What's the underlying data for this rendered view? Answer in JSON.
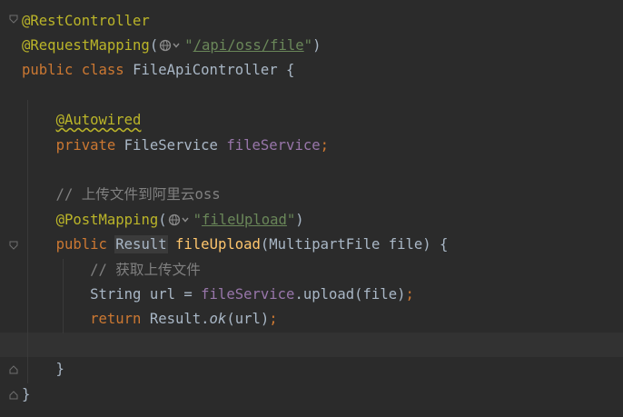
{
  "editor": {
    "lines": [
      {
        "parts": [
          {
            "t": "@RestController",
            "c": "ann"
          }
        ]
      },
      {
        "parts": [
          {
            "t": "@RequestMapping",
            "c": "ann"
          },
          {
            "t": "(",
            "c": ""
          },
          {
            "inlay": "globe-icon"
          },
          {
            "t": "\"",
            "c": "str"
          },
          {
            "t": "/api/oss/file",
            "c": "str-link"
          },
          {
            "t": "\"",
            "c": "str"
          },
          {
            "t": ")",
            "c": ""
          }
        ]
      },
      {
        "parts": [
          {
            "t": "public class ",
            "c": "kw"
          },
          {
            "t": "FileApiController {",
            "c": ""
          }
        ]
      },
      {
        "parts": []
      },
      {
        "parts": [
          {
            "t": "    ",
            "c": ""
          },
          {
            "t": "@Autowired",
            "c": "ann warn-underline"
          }
        ]
      },
      {
        "parts": [
          {
            "t": "    ",
            "c": ""
          },
          {
            "t": "private ",
            "c": "kw"
          },
          {
            "t": "FileService ",
            "c": ""
          },
          {
            "t": "fileService",
            "c": "fld"
          },
          {
            "t": ";",
            "c": "kw"
          }
        ]
      },
      {
        "parts": []
      },
      {
        "parts": [
          {
            "t": "    // 上传文件到阿里云oss",
            "c": "cmt"
          }
        ]
      },
      {
        "parts": [
          {
            "t": "    ",
            "c": ""
          },
          {
            "t": "@PostMapping",
            "c": "ann"
          },
          {
            "t": "(",
            "c": ""
          },
          {
            "inlay": "globe-icon"
          },
          {
            "t": "\"",
            "c": "str"
          },
          {
            "t": "fileUpload",
            "c": "str-link"
          },
          {
            "t": "\"",
            "c": "str"
          },
          {
            "t": ")",
            "c": ""
          }
        ]
      },
      {
        "parts": [
          {
            "t": "    ",
            "c": ""
          },
          {
            "t": "public ",
            "c": "kw"
          },
          {
            "t": "Result",
            "c": "hl-usage"
          },
          {
            "t": " ",
            "c": ""
          },
          {
            "t": "fileUpload",
            "c": "method-decl"
          },
          {
            "t": "(MultipartFile file) {",
            "c": ""
          }
        ]
      },
      {
        "parts": [
          {
            "t": "        // 获取上传文件",
            "c": "cmt"
          }
        ]
      },
      {
        "parts": [
          {
            "t": "        String url = ",
            "c": ""
          },
          {
            "t": "fileService",
            "c": "fld"
          },
          {
            "t": ".upload(file)",
            "c": ""
          },
          {
            "t": ";",
            "c": "kw"
          }
        ]
      },
      {
        "parts": [
          {
            "t": "        ",
            "c": ""
          },
          {
            "t": "return ",
            "c": "kw"
          },
          {
            "t": "Result.",
            "c": ""
          },
          {
            "t": "ok",
            "c": "ital"
          },
          {
            "t": "(url)",
            "c": ""
          },
          {
            "t": ";",
            "c": "kw"
          }
        ]
      },
      {
        "parts": [],
        "current": true
      },
      {
        "parts": [
          {
            "t": "    }",
            "c": ""
          }
        ]
      },
      {
        "parts": [
          {
            "t": "}",
            "c": ""
          }
        ]
      }
    ]
  },
  "colors": {
    "background": "#2b2b2b",
    "current_line": "#323232",
    "annotation": "#bbb529",
    "keyword": "#cc7832",
    "field": "#9876aa",
    "string": "#6a8759",
    "comment": "#808080",
    "method": "#ffc66d",
    "default_text": "#a9b7c6"
  }
}
